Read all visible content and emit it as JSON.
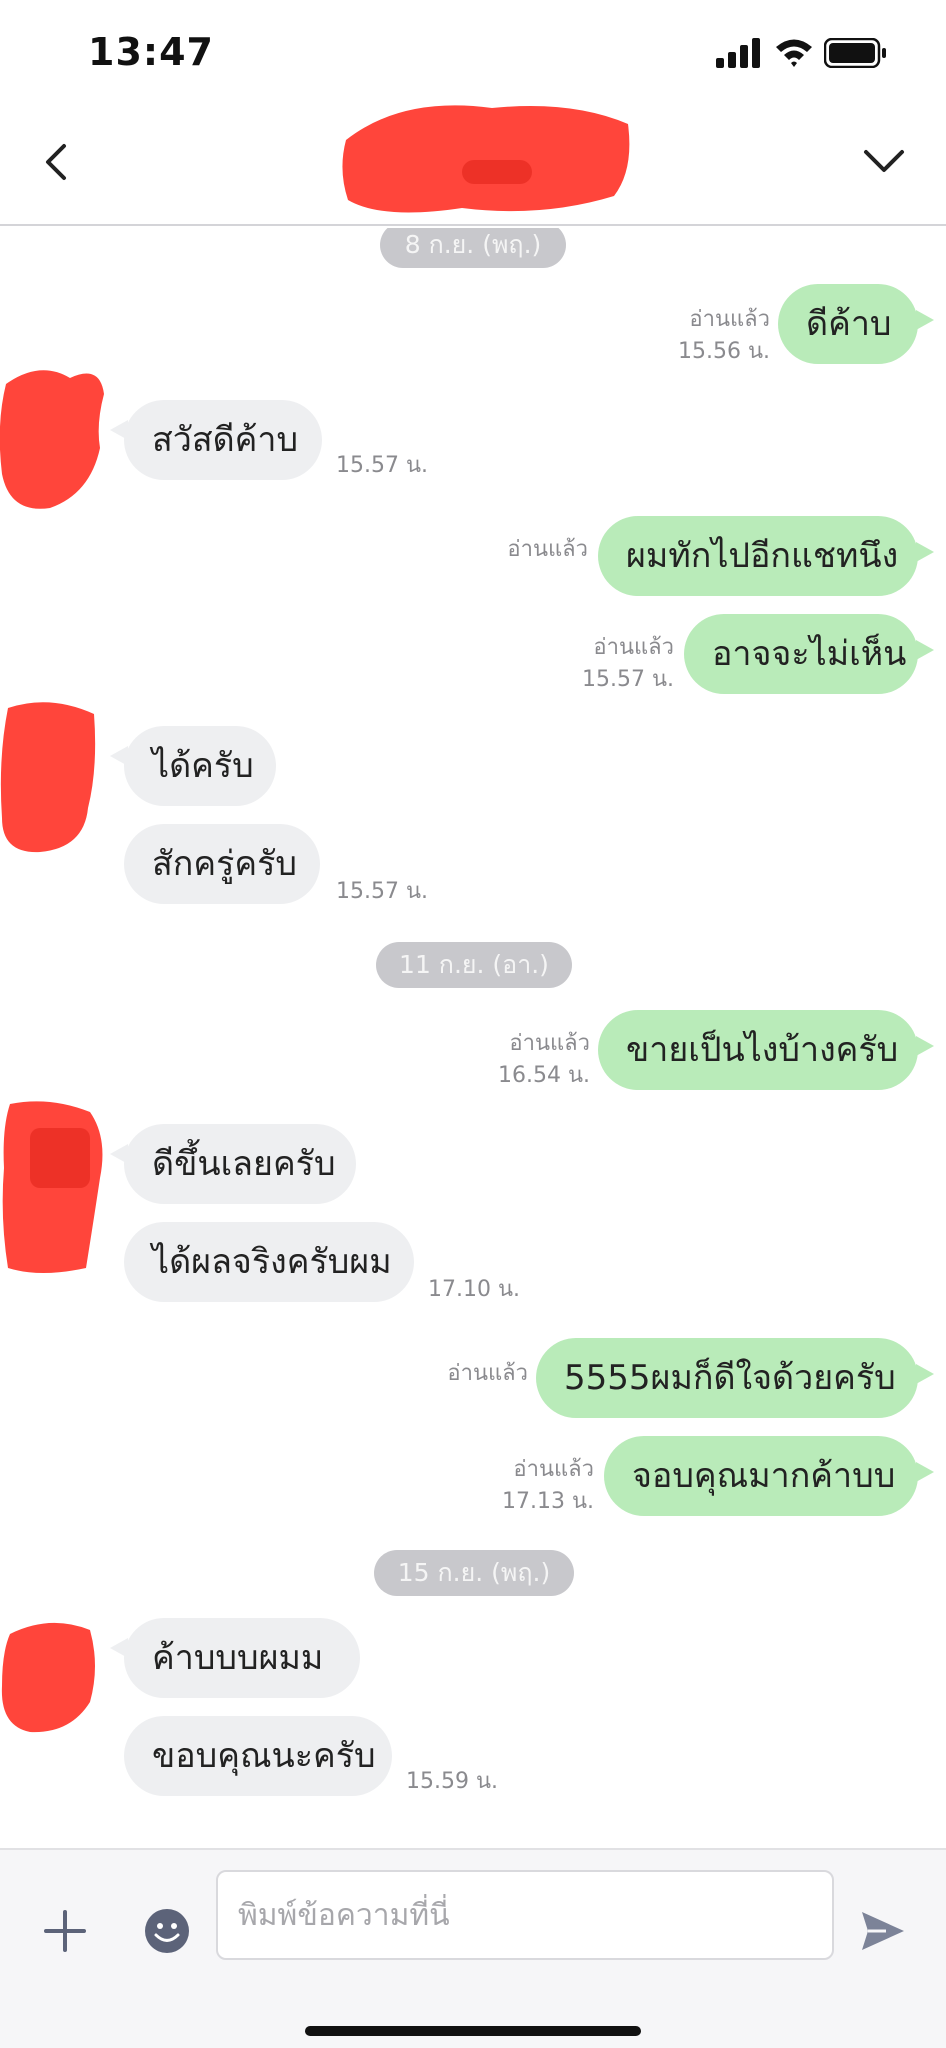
{
  "status_bar": {
    "time": "13:47"
  },
  "header": {
    "contact_name": "",
    "name_redacted": true
  },
  "messages": [
    {
      "type": "date",
      "text": "8 ก.ย. (พฤ.)"
    },
    {
      "type": "out",
      "text": "ดีค้าบ",
      "read": "อ่านแล้ว",
      "time": "15.56 น."
    },
    {
      "type": "in",
      "text": "สวัสดีค้าบ",
      "time": "15.57 น."
    },
    {
      "type": "out",
      "text": "ผมทักไปอีกแชทนึง",
      "read": "อ่านแล้ว",
      "time": ""
    },
    {
      "type": "out",
      "text": "อาจจะไม่เห็น",
      "read": "อ่านแล้ว",
      "time": "15.57 น."
    },
    {
      "type": "in",
      "text": "ได้ครับ",
      "time": ""
    },
    {
      "type": "in",
      "text": "สักครู่ครับ",
      "time": "15.57 น."
    },
    {
      "type": "date",
      "text": "11 ก.ย. (อา.)"
    },
    {
      "type": "out",
      "text": "ขายเป็นไงบ้างครับ",
      "read": "อ่านแล้ว",
      "time": "16.54 น."
    },
    {
      "type": "in",
      "text": "ดีขึ้นเลยครับ",
      "time": ""
    },
    {
      "type": "in",
      "text": "ได้ผลจริงครับผม",
      "time": "17.10 น."
    },
    {
      "type": "out",
      "text": "5555ผมก็ดีใจด้วยครับ",
      "read": "อ่านแล้ว",
      "time": ""
    },
    {
      "type": "out",
      "text": "จอบคุณมากค้าบบ",
      "read": "อ่านแล้ว",
      "time": "17.13 น."
    },
    {
      "type": "date",
      "text": "15 ก.ย. (พฤ.)"
    },
    {
      "type": "in",
      "text": "ค้าบบบผมม",
      "time": ""
    },
    {
      "type": "in",
      "text": "ขอบคุณนะครับ",
      "time": "15.59 น."
    }
  ],
  "input": {
    "placeholder": "พิมพ์ข้อความที่นี่",
    "value": ""
  },
  "colors": {
    "outgoing_bubble": "#b9ebb9",
    "incoming_bubble": "#eeeff1",
    "date_pill": "#c8c8cc",
    "redaction": "#ff3b30",
    "meta_text": "#8a8a8e",
    "icon": "#5c6379",
    "send_icon": "#7c8398"
  },
  "icons": {
    "back": "chevron-left-icon",
    "menu": "chevron-down-icon",
    "plus": "plus-icon",
    "emoji": "smiley-icon",
    "send": "send-icon"
  }
}
